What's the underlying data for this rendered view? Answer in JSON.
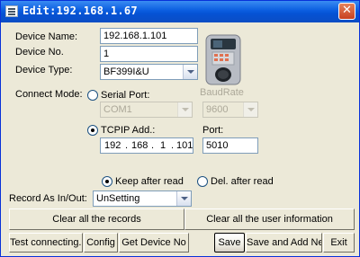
{
  "window": {
    "title": "Edit:192.168.1.67",
    "close_glyph": "✕"
  },
  "form": {
    "device_name": {
      "label": "Device Name:",
      "value": "192.168.1.101"
    },
    "device_no": {
      "label": "Device No.",
      "value": "1"
    },
    "device_type": {
      "label": "Device Type:",
      "value": "BF399I&U"
    },
    "connect_mode": {
      "label": "Connect Mode:"
    },
    "serial_port": {
      "label": "Serial Port:",
      "value": "COM1",
      "selected": false
    },
    "baud_rate": {
      "label": "BaudRate",
      "value": "9600"
    },
    "tcpip": {
      "label": "TCPIP Add.:",
      "selected": true,
      "octets": [
        "192",
        "168",
        "1",
        "101"
      ]
    },
    "port": {
      "label": "Port:",
      "value": "5010"
    },
    "keep_after_read": {
      "label": "Keep after read",
      "selected": true
    },
    "del_after_read": {
      "label": "Del. after read",
      "selected": false
    },
    "record_as": {
      "label": "Record As In/Out:",
      "value": "UnSetting"
    }
  },
  "buttons": {
    "clear_records": "Clear all the records",
    "clear_user_info": "Clear all the user information",
    "test_connecting": "Test connecting...",
    "config": "Config",
    "get_device_no": "Get Device No",
    "save": "Save",
    "save_and_add_next": "Save and Add Next",
    "exit": "Exit"
  }
}
